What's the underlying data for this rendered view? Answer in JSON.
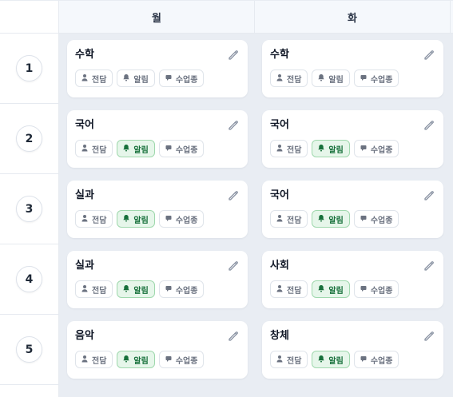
{
  "days": [
    "월",
    "화"
  ],
  "chip_labels": {
    "homeroom": "전담",
    "alarm": "알림",
    "class_type": "수업종"
  },
  "colors": {
    "alarm_on_bg": "#e6f6ea",
    "alarm_on_text": "#16703a",
    "cell_bg": "#e9edf3"
  },
  "icons": {
    "homeroom": "person-icon",
    "alarm": "bell-icon",
    "class_type": "chat-icon",
    "edit": "pencil-icon"
  },
  "periods": [
    {
      "number": "1",
      "cells": [
        {
          "subject": "수학",
          "alarm_on": false
        },
        {
          "subject": "수학",
          "alarm_on": false
        }
      ]
    },
    {
      "number": "2",
      "cells": [
        {
          "subject": "국어",
          "alarm_on": true
        },
        {
          "subject": "국어",
          "alarm_on": true
        }
      ]
    },
    {
      "number": "3",
      "cells": [
        {
          "subject": "실과",
          "alarm_on": true
        },
        {
          "subject": "국어",
          "alarm_on": true
        }
      ]
    },
    {
      "number": "4",
      "cells": [
        {
          "subject": "실과",
          "alarm_on": true
        },
        {
          "subject": "사회",
          "alarm_on": true
        }
      ]
    },
    {
      "number": "5",
      "cells": [
        {
          "subject": "음악",
          "alarm_on": true
        },
        {
          "subject": "창체",
          "alarm_on": true
        }
      ]
    }
  ]
}
